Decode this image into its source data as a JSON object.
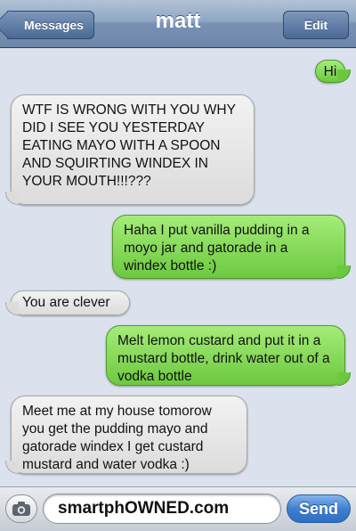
{
  "header": {
    "back_label": "Messages",
    "title": "matt",
    "edit_label": "Edit"
  },
  "messages": [
    {
      "from": "me",
      "text": "Hi"
    },
    {
      "from": "them",
      "text": "WTF IS WRONG WITH YOU WHY DID I SEE YOU YESTERDAY EATING MAYO WITH A SPOON AND SQUIRTING WINDEX IN YOUR MOUTH!!!???"
    },
    {
      "from": "me",
      "text": "Haha I put vanilla pudding in a moyo jar and gatorade in a windex bottle :)"
    },
    {
      "from": "them",
      "text": "You are clever"
    },
    {
      "from": "me",
      "text": "Melt lemon custard and put it in a mustard bottle, drink water out of a vodka bottle"
    },
    {
      "from": "them",
      "text": "Meet me at my house tomorow you get the pudding mayo and gatorade windex I get custard mustard and water vodka :)"
    }
  ],
  "input": {
    "value": "smartphOWNED.com",
    "send_label": "Send",
    "camera_icon": "camera-icon"
  },
  "colors": {
    "sent_bubble": "#7dd24d",
    "received_bubble": "#e6e6e6",
    "nav_bar": "#7f98b8",
    "send_button": "#3f7fd0"
  }
}
